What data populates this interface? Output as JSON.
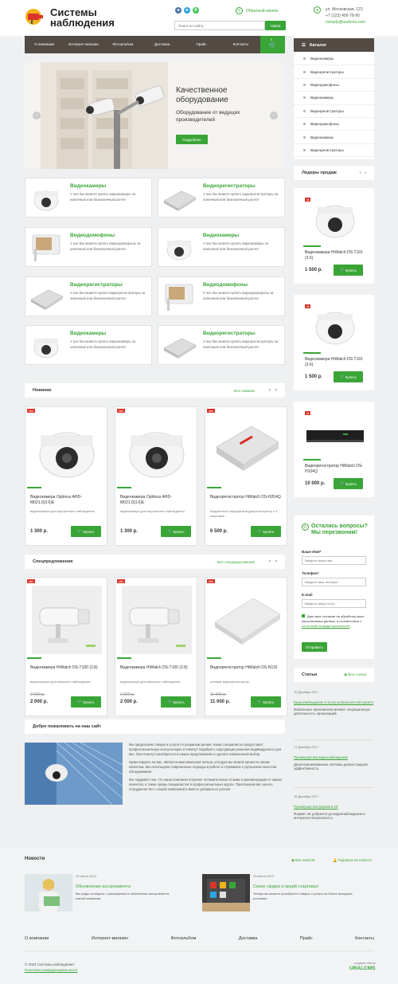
{
  "header": {
    "title": "Системы наблюдения",
    "callback": "Обратный звонок",
    "address": "ул. Московская, 123",
    "phone": "+7 (123) 456-78-90",
    "email": "noreply@uralcms.com",
    "search_placeholder": "Поиск по сайту",
    "search_button": "Найти",
    "cart_count": "0"
  },
  "nav": [
    "О компании",
    "Интернет-магазин",
    "Фотоальбом",
    "Доставка",
    "Прайс",
    "Контакты"
  ],
  "catalog": {
    "title": "Каталог",
    "items": [
      "Видеокамеры",
      "Видеорегистраторы",
      "Видеодомофоны",
      "Видеокамеры",
      "Видеорегистраторы",
      "Видеодомофоны",
      "Видеокамеры",
      "Видеорегистраторы"
    ]
  },
  "slider": {
    "title": "Качественное оборудование",
    "subtitle": "Оборудование от ведущих производителей",
    "button": "Подробнее"
  },
  "tiles": [
    {
      "title": "Видеокамеры",
      "desc": "У нас Вы можете купить видеокамеры за наличный или безналичный расчет"
    },
    {
      "title": "Видеорегистраторы",
      "desc": "У нас Вы можете купить видеорегистраторы за наличный или безналичный расчет"
    },
    {
      "title": "Видеодомофоны",
      "desc": "У нас Вы можете купить видеодомофоны за наличный или безналичный расчет"
    },
    {
      "title": "Видеокамеры",
      "desc": "У нас Вы можете купить видеокамеры за наличный или безналичный расчет"
    },
    {
      "title": "Видеорегистраторы",
      "desc": "У нас Вы можете купить видеорегистраторы за наличный или безналичный расчет"
    },
    {
      "title": "Видеодомофоны",
      "desc": "У нас Вы можете купить видеодомофоны за наличный или безналичный расчет"
    },
    {
      "title": "Видеокамеры",
      "desc": "У нас Вы можете купить видеокамеры за наличный или безналичный расчет"
    },
    {
      "title": "Видеорегистраторы",
      "desc": "У нас Вы можете купить видеорегистраторы за наличный или безналичный расчет"
    }
  ],
  "new_section": {
    "title": "Новинки",
    "all": "Все новинки",
    "products": [
      {
        "badge": "new",
        "name": "Видеокамера Optimus AHD-M021.0(3.6)E",
        "desc": "видеокамера для внутреннего наблюдения",
        "price": "1 300 р.",
        "buy": "Купить"
      },
      {
        "badge": "new",
        "name": "Видеокамера Optimus AHD-M021.0(3.6)E",
        "desc": "видеокамера для внутреннего наблюдения",
        "price": "1 300 р.",
        "buy": "Купить"
      },
      {
        "badge": "new",
        "name": "Видеорегистратор HiWatch DS-H204Q",
        "desc": "Бюджетный гибридный видеорегистратор с 4 каналами",
        "price": "6 500 р.",
        "buy": "Купить"
      }
    ]
  },
  "special_section": {
    "title": "Спецпредложения",
    "all": "Все спецпредложения",
    "products": [
      {
        "badge": "sale",
        "name": "Видеокамера HiWatch DS-T100 (2.8)",
        "desc": "видеокамера для внешнего наблюдения",
        "old": "2 000 р.",
        "price": "2 000 р.",
        "buy": "Купить"
      },
      {
        "badge": "sale",
        "name": "Видеокамера HiWatch DS-T100 (2.8)",
        "desc": "видеокамера для внешнего наблюдения",
        "old": "2 000 р.",
        "price": "2 000 р.",
        "buy": "Купить"
      },
      {
        "badge": "sale",
        "name": "Видеорегистратор HiWatch DS-N116",
        "desc": "сетевой видеорегистратор",
        "old": "11 500 р.",
        "price": "11 000 р.",
        "buy": "Купить"
      }
    ]
  },
  "welcome": {
    "title": "Добро пожаловать на наш сайт",
    "p1": "Мы предлагаем товары и услуги по разумным ценам. Наши специалисты предоставят профессиональную консультацию и помогут подобрать подходящие решения индивидуально для вас. Они помогут разобраться в наших предложениях и сделать взвешенный выбор.",
    "p2": "Ориентируясь на вас, является максимальная польза, которую мы можем принести своим клиентам. Мы используем современные подходы в работе и стремимся к улучшению качества обслуживания.",
    "p3": "Мы гордимся тем, что наша компания получает положительные отзывы и рекомендации от наших клиентов, а также среди специалистов в профессиональных кругах. Приглашаем вас начать сотрудничество с нашей компанией и вместе добиваться успеха!"
  },
  "leaders": {
    "title": "Лидеры продаж",
    "items": [
      {
        "badge": "hit",
        "name": "Видеокамера HiWatch DS-T101 (3.6)",
        "price": "1 500 р.",
        "buy": "Купить"
      },
      {
        "badge": "hit",
        "name": "Видеокамера HiWatch DS-T101 (3.6)",
        "price": "1 500 р.",
        "buy": "Купить"
      },
      {
        "badge": "hit",
        "name": "Видеорегистратор HiWatch DS-H104Q",
        "price": "10 000 р.",
        "buy": "Купить"
      }
    ]
  },
  "form": {
    "title": "Остались вопросы? Мы перезвоним!",
    "name_label": "Ваше Имя*",
    "name_ph": "Введите ваше имя",
    "phone_label": "Телефон*",
    "phone_ph": "Введите ваш телефон",
    "email_label": "E-mail",
    "email_ph": "Введите вашу почту",
    "consent": "Даю свое согласие на обработку моих персональных данных, в соответствии с",
    "consent_link": "политикой конфиденциальности",
    "submit": "Отправить"
  },
  "articles": {
    "title": "Статьи",
    "all": "Все статьи",
    "items": [
      {
        "date": "10 Декабря 2017",
        "title": "Видеонаблюдение в эпоху мобильного Интернета",
        "desc": "Мобильные приложения меняют операционную деятельность организаций."
      },
      {
        "date": "17 Декабря 2017",
        "title": "Преимущества видеонаблюдения",
        "desc": "Децентрализованные системы демонстрируют эффективность."
      },
      {
        "date": "16 Декабря 2017",
        "title": "Преимущества формата 4K",
        "desc": "Формат 4K добрался до видеонаблюдения и интересна безопасность."
      }
    ]
  },
  "news": {
    "title": "Новости",
    "all": "Все новости",
    "subscribe": "Подписка на новости",
    "items": [
      {
        "date": "12 Июня 2024",
        "title": "Обновление ассортимента",
        "desc": "Мы рады сообщить о расширении и обновлении ассортимента нашей компании."
      },
      {
        "date": "09 Июня 2024",
        "title": "Сезон скидок и акций стартовал",
        "desc": "Теперь вы можете приобрести товары и услуги на более выгодных условиях."
      }
    ]
  },
  "footer": {
    "nav": [
      "О компании",
      "Интернет-магазин",
      "Фотоальбом",
      "Доставка",
      "Прайс",
      "Контакты"
    ],
    "copyright": "© 2024 Системы наблюдения",
    "privacy": "Политика конфиденциальности",
    "dev_label": "создание сайтов",
    "dev": "URALCMS"
  },
  "colors": {
    "accent": "#3aa537",
    "nav": "#524a43",
    "badge": "#d9342b"
  }
}
